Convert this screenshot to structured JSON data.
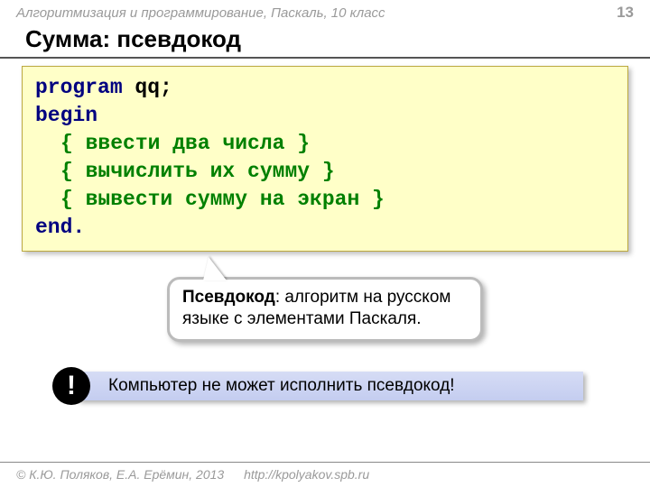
{
  "header": {
    "course": "Алгоритмизация и программирование, Паскаль, 10 класс",
    "page": "13"
  },
  "title": "Сумма: псевдокод",
  "code": {
    "l1a": "program",
    "l1b": " qq;",
    "l2": "begin",
    "l3": "{ ввести два числа }",
    "l4": "{ вычислить их сумму }",
    "l5": "{ вывести сумму на экран }",
    "l6": "end."
  },
  "callout": {
    "term": "Псевдокод",
    "rest": ": алгоритм на русском языке с элементами Паскаля."
  },
  "alert": {
    "badge": "!",
    "text": "Компьютер не может исполнить псевдокод!"
  },
  "footer": {
    "copyright": "© К.Ю. Поляков, Е.А. Ерёмин, 2013",
    "url": "http://kpolyakov.spb.ru"
  }
}
